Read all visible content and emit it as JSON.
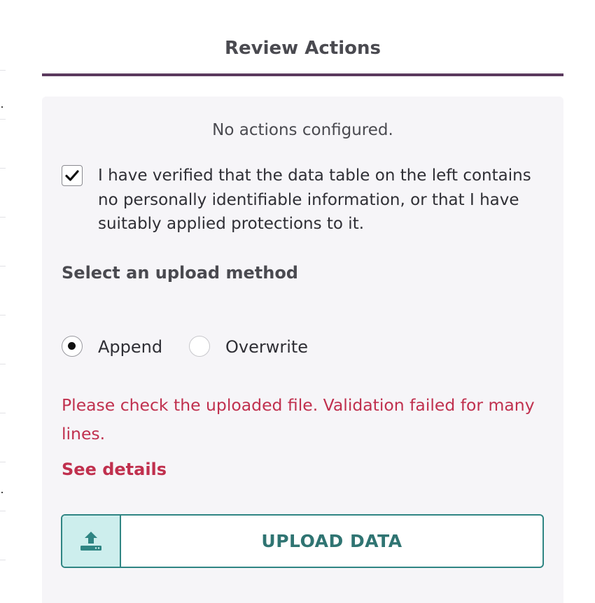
{
  "panel": {
    "title": "Review Actions"
  },
  "actions": {
    "empty_message": "No actions configured."
  },
  "verification": {
    "checked": true,
    "text": "I have verified that the data table on the left contains no personally identifiable information, or that I have suitably applied protections to it."
  },
  "upload_method": {
    "label": "Select an upload method",
    "options": [
      {
        "label": "Append",
        "selected": true
      },
      {
        "label": "Overwrite",
        "selected": false
      }
    ]
  },
  "validation": {
    "error_message": "Please check the uploaded file. Validation failed for many lines.",
    "details_link": "See details"
  },
  "upload_button": {
    "label": "UPLOAD DATA",
    "icon": "upload-icon"
  },
  "colors": {
    "accent": "#5b3a5e",
    "error": "#c0304e",
    "button_teal": "#2f8583",
    "icon_bg": "#cdeeed"
  }
}
